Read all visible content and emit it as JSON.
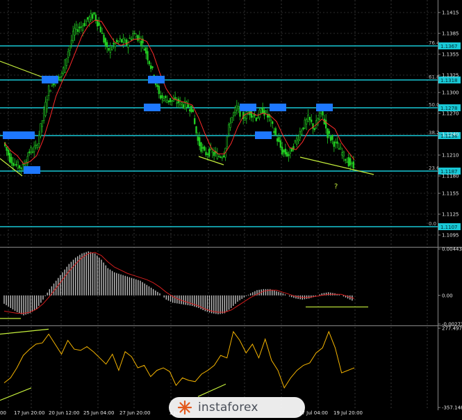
{
  "chart_data": {
    "type": "candlestick",
    "colors": {
      "background": "#000000",
      "grid": "#5a5a5a",
      "candle": "#22cc22",
      "ma": "#ff2a2a",
      "level_line": "#19c8d6",
      "level_marker": "#1e78ff",
      "trend_line": "#c6f03c",
      "histogram": "#c0c0c0",
      "signal": "#d21e1e",
      "cci": "#f5b400",
      "label_box": "#19c8d6"
    },
    "price_axis": {
      "ylim": [
        1.1081,
        1.1429
      ],
      "ticks": [
        "1.1415",
        "1.1385",
        "1.1355",
        "1.1325",
        "1.1300",
        "1.1270",
        "1.1240",
        "1.1210",
        "1.1180",
        "1.1155",
        "1.1125",
        "1.1095"
      ]
    },
    "time_axis": {
      "labels": [
        "00",
        "17 Jun 20:00",
        "20 Jun 12:00",
        "25 Jun 04:00",
        "27 Jun 20:00",
        "2 Jul",
        "17 Jul 04:00",
        "19 Jul 20:00"
      ]
    },
    "fib_levels": [
      {
        "ratio": "76.4",
        "price": "1.1367",
        "value": 1.1367
      },
      {
        "ratio": "61.8",
        "price": "1.1318",
        "value": 1.1318
      },
      {
        "ratio": "50.0",
        "price": "1.1278",
        "value": 1.1278
      },
      {
        "ratio": "38.2",
        "price": "1.1238",
        "value": 1.1238
      },
      {
        "ratio": "23.6",
        "price": "1.1187",
        "value": 1.1187
      },
      {
        "ratio": "0.0",
        "price": "1.1107",
        "value": 1.1107
      }
    ],
    "annotations": [
      "?"
    ],
    "price_series": [
      1.1228,
      1.1205,
      1.1195,
      1.1192,
      1.1215,
      1.122,
      1.126,
      1.1305,
      1.132,
      1.1325,
      1.136,
      1.139,
      1.1395,
      1.1405,
      1.1412,
      1.139,
      1.136,
      1.1368,
      1.1375,
      1.137,
      1.1384,
      1.1378,
      1.1358,
      1.133,
      1.1296,
      1.129,
      1.1288,
      1.1286,
      1.1282,
      1.1278,
      1.123,
      1.1212,
      1.1215,
      1.1208,
      1.1212,
      1.126,
      1.1278,
      1.1265,
      1.1272,
      1.1264,
      1.1275,
      1.1262,
      1.1238,
      1.1215,
      1.121,
      1.1228,
      1.1248,
      1.1262,
      1.1248,
      1.1275,
      1.124,
      1.1228,
      1.1216,
      1.1202,
      1.1192
    ],
    "macd": {
      "ylim": [
        -0.00273,
        0.00443
      ],
      "ticks": [
        "0.00443",
        "0.00",
        "-0.00273"
      ],
      "histogram": [
        -0.0008,
        -0.0012,
        -0.0016,
        -0.0019,
        -0.0017,
        -0.0013,
        -0.0004,
        0.0006,
        0.0014,
        0.0022,
        0.003,
        0.0036,
        0.004,
        0.0042,
        0.004,
        0.0034,
        0.0026,
        0.0022,
        0.002,
        0.0018,
        0.0016,
        0.0014,
        0.001,
        0.0006,
        0.0002,
        -0.0004,
        -0.0007,
        -0.0008,
        -0.0009,
        -0.001,
        -0.0012,
        -0.0015,
        -0.0017,
        -0.0018,
        -0.0017,
        -0.0012,
        -0.0006,
        -0.0002,
        0.0002,
        0.0005,
        0.0006,
        0.0006,
        0.0004,
        0.0002,
        -0.0001,
        -0.0003,
        -0.0004,
        -0.0003,
        -0.0001,
        0.0002,
        0.0003,
        0.0002,
        0.0,
        -0.0003,
        -0.0006
      ],
      "signal": [
        -0.0015,
        -0.0016,
        -0.0017,
        -0.0017,
        -0.0016,
        -0.0013,
        -0.0008,
        -0.0001,
        0.0007,
        0.0015,
        0.0023,
        0.003,
        0.0036,
        0.004,
        0.0041,
        0.0038,
        0.0032,
        0.0027,
        0.0024,
        0.0021,
        0.0019,
        0.0017,
        0.0015,
        0.0012,
        0.0008,
        0.0003,
        -0.0001,
        -0.0004,
        -0.0006,
        -0.0008,
        -0.001,
        -0.0013,
        -0.0015,
        -0.0016,
        -0.0016,
        -0.0014,
        -0.001,
        -0.0006,
        -0.0002,
        0.0001,
        0.0004,
        0.0005,
        0.0005,
        0.0003,
        0.0001,
        -0.0001,
        -0.0002,
        -0.0002,
        -0.0001,
        0.0,
        0.0001,
        0.0001,
        0.0001,
        -0.0001,
        -0.0003
      ]
    },
    "cci": {
      "ylim": [
        -357.148,
        277.4971
      ],
      "ticks": [
        "277.4971",
        "-357.148"
      ],
      "values": [
        -160,
        -120,
        -40,
        60,
        110,
        150,
        160,
        230,
        150,
        70,
        180,
        110,
        100,
        130,
        90,
        40,
        -10,
        70,
        -60,
        90,
        50,
        -40,
        -20,
        -110,
        -60,
        -40,
        -70,
        -180,
        -120,
        -140,
        -150,
        -90,
        -60,
        -20,
        60,
        40,
        250,
        180,
        80,
        150,
        40,
        190,
        20,
        -60,
        -200,
        -120,
        -60,
        -20,
        0,
        80,
        120,
        250,
        120,
        -80,
        -60,
        -40
      ]
    }
  },
  "watermark": {
    "text": "instaforex"
  }
}
